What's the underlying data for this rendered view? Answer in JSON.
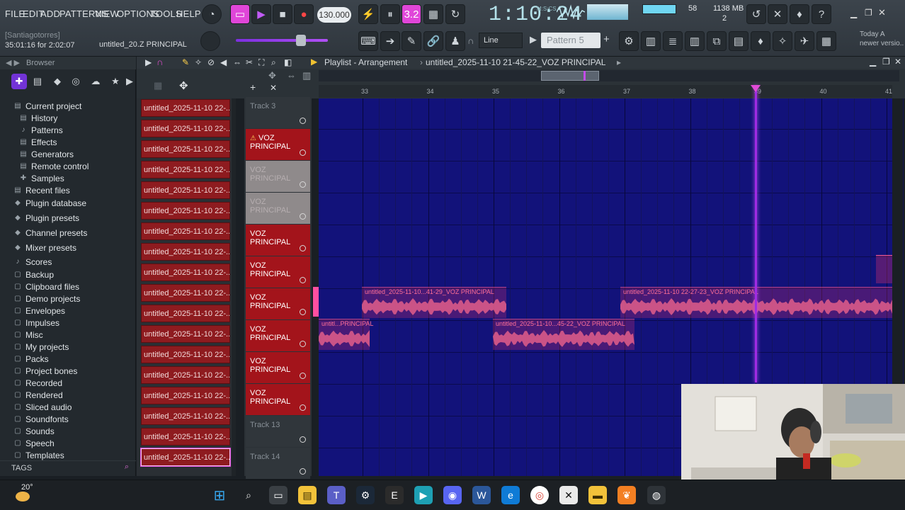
{
  "menu": [
    "FILE",
    "EDIT",
    "ADD",
    "PATTERNS",
    "VIEW",
    "OPTIONS",
    "TOOLS",
    "HELP"
  ],
  "transport": {
    "tempo": "130.000",
    "time": "1:10:24",
    "time_label": "M:S:CS",
    "rec_mode": "3.2"
  },
  "hint": {
    "user": "[Santiagotorres]",
    "time": "35:01:16 for 2:02:07",
    "file": "untitled_20.Z PRINCIPAL"
  },
  "status": {
    "cpu": "58",
    "memory": "1138 MB",
    "polyphony": "2"
  },
  "toolbar": {
    "snap": "Line",
    "pattern": "Pattern 5",
    "news": [
      "Today  A",
      "newer versio.."
    ]
  },
  "browser": {
    "title": "Browser",
    "items": [
      {
        "label": "Current project",
        "icon": "▤"
      },
      {
        "label": "History",
        "icon": "▤",
        "sub": true
      },
      {
        "label": "Patterns",
        "icon": "♪",
        "sub": true
      },
      {
        "label": "Effects",
        "icon": "▤",
        "sub": true
      },
      {
        "label": "Generators",
        "icon": "▤",
        "sub": true
      },
      {
        "label": "Remote control",
        "icon": "▤",
        "sub": true
      },
      {
        "label": "Samples",
        "icon": "✚",
        "sub": true
      },
      {
        "label": "Recent files",
        "icon": "▤"
      },
      {
        "label": "Plugin database",
        "icon": "◆"
      },
      {
        "label": "Plugin presets",
        "icon": "◆"
      },
      {
        "label": "Channel presets",
        "icon": "◆"
      },
      {
        "label": "Mixer presets",
        "icon": "◆"
      },
      {
        "label": "Scores",
        "icon": "♪"
      },
      {
        "label": "Backup",
        "icon": "▢"
      },
      {
        "label": "Clipboard files",
        "icon": "▢"
      },
      {
        "label": "Demo projects",
        "icon": "▢"
      },
      {
        "label": "Envelopes",
        "icon": "▢"
      },
      {
        "label": "Impulses",
        "icon": "▢"
      },
      {
        "label": "Misc",
        "icon": "▢"
      },
      {
        "label": "My projects",
        "icon": "▢"
      },
      {
        "label": "Packs",
        "icon": "▢"
      },
      {
        "label": "Project bones",
        "icon": "▢"
      },
      {
        "label": "Recorded",
        "icon": "▢"
      },
      {
        "label": "Rendered",
        "icon": "▢"
      },
      {
        "label": "Sliced audio",
        "icon": "▢"
      },
      {
        "label": "Soundfonts",
        "icon": "▢"
      },
      {
        "label": "Sounds",
        "icon": "▢"
      },
      {
        "label": "Speech",
        "icon": "▢"
      },
      {
        "label": "Templates",
        "icon": "▢"
      }
    ],
    "tags_label": "TAGS"
  },
  "playlist": {
    "title": "Playlist - Arrangement",
    "breadcrumb": "untitled_2025-11-10 21-45-22_VOZ PRINCIPAL",
    "ruler": [
      "33",
      "34",
      "35",
      "36",
      "37",
      "38",
      "39",
      "40",
      "41"
    ],
    "clip_names": [
      "untitled_2025-11-10 22-...",
      "untitled_2025-11-10 22-...",
      "untitled_2025-11-10 22-...",
      "untitled_2025-11-10 22-...",
      "untitled_2025-11-10 22-...",
      "untitled_2025-11-10 22-...",
      "untitled_2025-11-10 22-...",
      "untitled_2025-11-10 22-...",
      "untitled_2025-11-10 22-...",
      "untitled_2025-11-10 22-...",
      "untitled_2025-11-10 22-...",
      "untitled_2025-11-10 22-...",
      "untitled_2025-11-10 22-...",
      "untitled_2025-11-10 22-...",
      "untitled_2025-11-10 22-...",
      "untitled_2025-11-10 22-...",
      "untitled_2025-11-10 22-...",
      "untitled_2025-11-10 22-..."
    ],
    "tracks": [
      {
        "label": "Track 3",
        "style": "grey"
      },
      {
        "label": "VOZ PRINCIPAL",
        "style": "red",
        "warn": true
      },
      {
        "label": "VOZ PRINCIPAL",
        "style": "dim"
      },
      {
        "label": "VOZ PRINCIPAL",
        "style": "dim"
      },
      {
        "label": "VOZ PRINCIPAL",
        "style": "red"
      },
      {
        "label": "VOZ PRINCIPAL",
        "style": "red"
      },
      {
        "label": "VOZ PRINCIPAL",
        "style": "red"
      },
      {
        "label": "VOZ PRINCIPAL",
        "style": "red"
      },
      {
        "label": "VOZ PRINCIPAL",
        "style": "red"
      },
      {
        "label": "VOZ PRINCIPAL",
        "style": "red"
      },
      {
        "label": "Track 13",
        "style": "grey"
      },
      {
        "label": "Track 14",
        "style": "grey"
      }
    ],
    "clips": [
      {
        "name": "untitled_2025-11-10...41-29_VOZ PRINCIPAL"
      },
      {
        "name": "untitled_2025-11-10 22-27-23_VOZ PRINCIPAL"
      },
      {
        "name": "untitl...PRINCIPAL"
      },
      {
        "name": "untitled_2025-11-10...45-22_VOZ PRINCIPAL"
      }
    ]
  },
  "taskbar": {
    "weather": "20°"
  }
}
